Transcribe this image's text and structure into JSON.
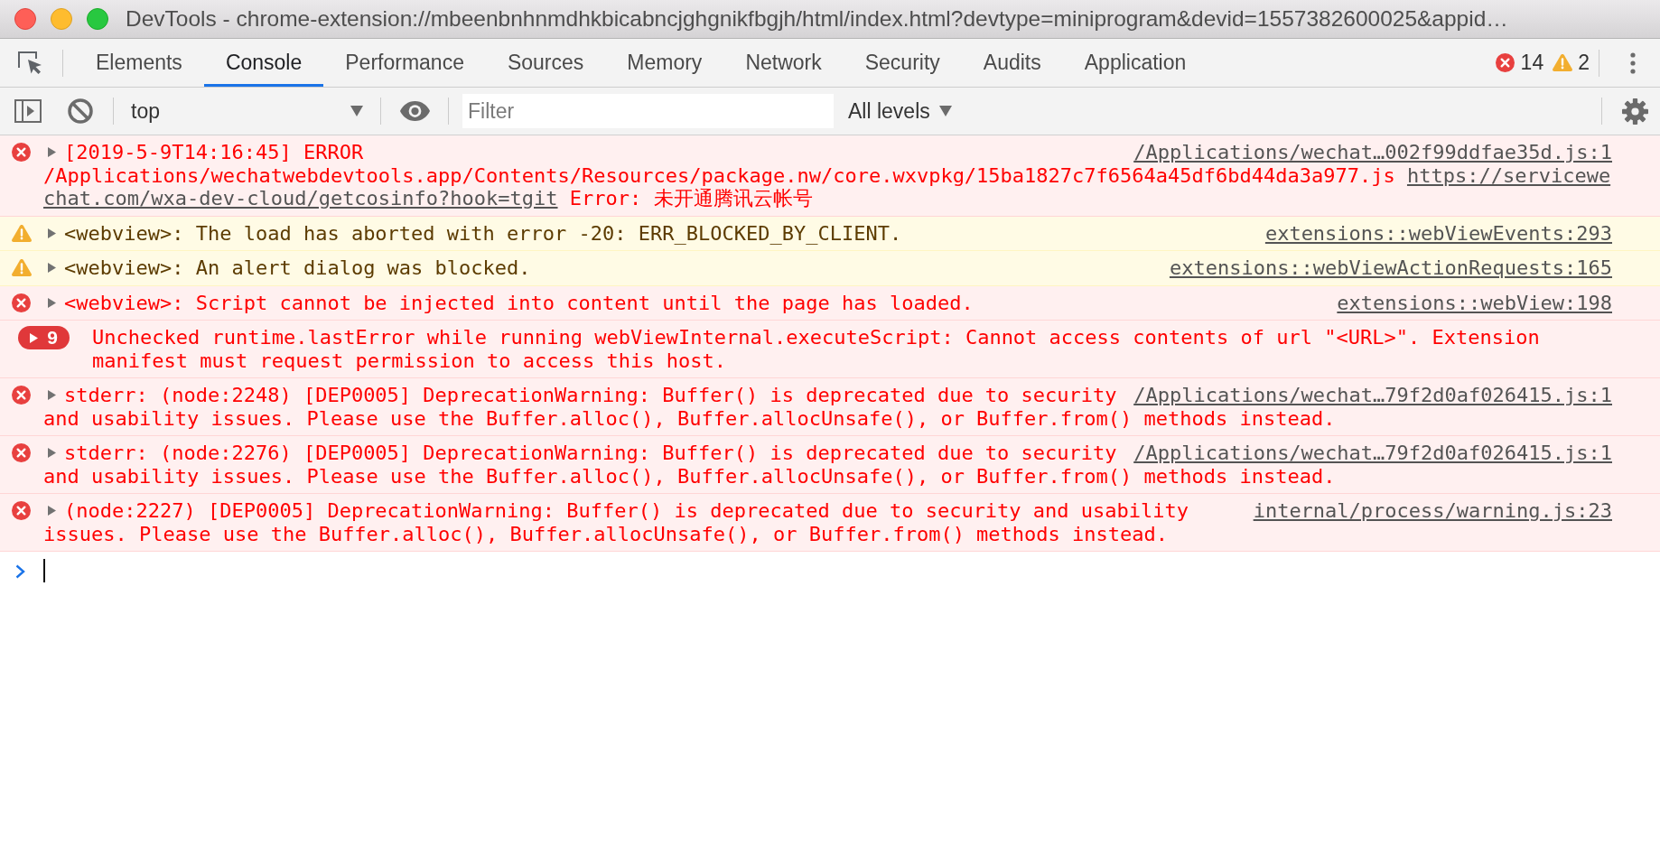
{
  "window": {
    "title": "DevTools - chrome-extension://mbeenbnhnmdhkbicabncjghgnikfbgjh/html/index.html?devtype=miniprogram&devid=1557382600025&appid…"
  },
  "tabs": [
    {
      "label": "Elements",
      "selected": false
    },
    {
      "label": "Console",
      "selected": true
    },
    {
      "label": "Performance",
      "selected": false
    },
    {
      "label": "Sources",
      "selected": false
    },
    {
      "label": "Memory",
      "selected": false
    },
    {
      "label": "Network",
      "selected": false
    },
    {
      "label": "Security",
      "selected": false
    },
    {
      "label": "Audits",
      "selected": false
    },
    {
      "label": "Application",
      "selected": false
    }
  ],
  "issue_counts": {
    "errors": "14",
    "warnings": "2"
  },
  "toolbar": {
    "context": "top",
    "filter": {
      "placeholder": "Filter"
    },
    "levels": "All levels"
  },
  "messages": [
    {
      "kind": "error",
      "expanded": false,
      "source": "/Applications/wechat…002f99ddfae35d.js:1",
      "lines": [
        [
          {
            "kind": "text",
            "text": "[2019-5-9T14:16:45] ERROR"
          }
        ],
        [
          {
            "kind": "text",
            "text": "/Applications/wechatwebdevtools.app/Contents/Resources/package.nw/core.wxvpkg/15ba1827c7f6564a45df6bd44da3a977.js "
          },
          {
            "kind": "link",
            "text": "https://servicewe"
          }
        ],
        [
          {
            "kind": "link",
            "text": "chat.com/wxa-dev-cloud/getcosinfo?hook=tgit"
          },
          {
            "kind": "text",
            "text": " Error: 未开通腾讯云帐号"
          }
        ]
      ]
    },
    {
      "kind": "warning",
      "expanded": false,
      "source": "extensions::webViewEvents:293",
      "lines": [
        [
          {
            "kind": "text",
            "text": "<webview>: The load has aborted with error -20: ERR_BLOCKED_BY_CLIENT."
          }
        ]
      ]
    },
    {
      "kind": "warning",
      "expanded": false,
      "source": "extensions::webViewActionRequests:165",
      "lines": [
        [
          {
            "kind": "text",
            "text": "<webview>: An alert dialog was blocked."
          }
        ]
      ]
    },
    {
      "kind": "error",
      "expanded": false,
      "source": "extensions::webView:198",
      "lines": [
        [
          {
            "kind": "text",
            "text": "<webview>: Script cannot be injected into content until the page has loaded."
          }
        ]
      ]
    },
    {
      "kind": "error",
      "expanded": false,
      "repeat": "9",
      "lines": [
        [
          {
            "kind": "text",
            "text": "Unchecked runtime.lastError while running webViewInternal.executeScript: Cannot access contents of url \"<URL>\". Extension"
          }
        ],
        [
          {
            "kind": "text",
            "text": "manifest must request permission to access this host."
          }
        ]
      ]
    },
    {
      "kind": "error",
      "expanded": false,
      "source": "/Applications/wechat…79f2d0af026415.js:1",
      "lines": [
        [
          {
            "kind": "text",
            "text": "stderr: (node:2248) [DEP0005] DeprecationWarning: Buffer() is deprecated due to security"
          }
        ],
        [
          {
            "kind": "text",
            "text": "and usability issues. Please use the Buffer.alloc(), Buffer.allocUnsafe(), or Buffer.from() methods instead."
          }
        ]
      ]
    },
    {
      "kind": "error",
      "expanded": false,
      "source": "/Applications/wechat…79f2d0af026415.js:1",
      "lines": [
        [
          {
            "kind": "text",
            "text": "stderr: (node:2276) [DEP0005] DeprecationWarning: Buffer() is deprecated due to security"
          }
        ],
        [
          {
            "kind": "text",
            "text": "and usability issues. Please use the Buffer.alloc(), Buffer.allocUnsafe(), or Buffer.from() methods instead."
          }
        ]
      ]
    },
    {
      "kind": "error",
      "expanded": false,
      "source": "internal/process/warning.js:23",
      "lines": [
        [
          {
            "kind": "text",
            "text": "(node:2227) [DEP0005] DeprecationWarning: Buffer() is deprecated due to security and usability"
          }
        ],
        [
          {
            "kind": "text",
            "text": "issues. Please use the Buffer.alloc(), Buffer.allocUnsafe(), or Buffer.from() methods instead."
          }
        ]
      ]
    }
  ]
}
